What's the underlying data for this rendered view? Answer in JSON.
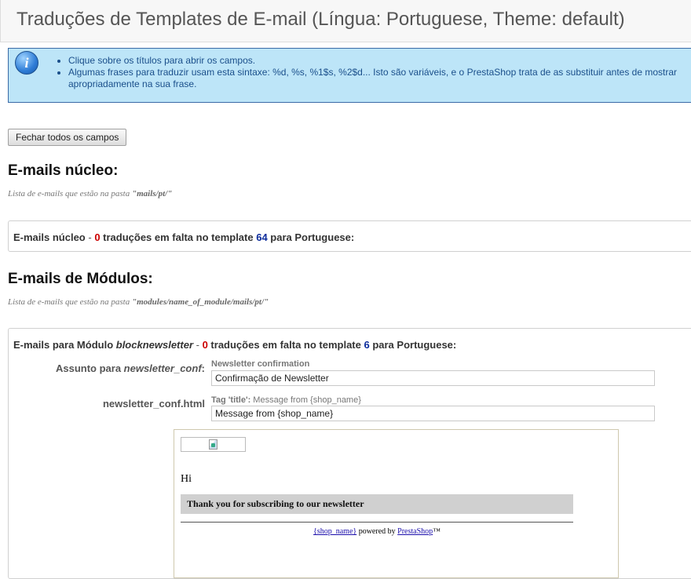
{
  "page_title": "Traduções de Templates de E-mail (Língua: Portuguese, Theme: default)",
  "info": {
    "items": [
      "Clique sobre os títulos para abrir os campos.",
      "Algumas frases para traduzir usam esta sintaxe: %d, %s, %1$s, %2$d... Isto são variáveis, e o PrestaShop trata de as substituir antes de mostrar apropriadamente na sua frase."
    ]
  },
  "close_all_button": "Fechar todos os campos",
  "core": {
    "heading": "E-mails núcleo:",
    "subtitle_prefix": "Lista de e-mails que estão na pasta ",
    "subtitle_path": "\"mails/pt/\"",
    "line_label": "E-mails núcleo",
    "dash": " - ",
    "missing_count": "0",
    "missing_text": " traduções em falta no template ",
    "template_count": "64",
    "lang_text": " para Portuguese:"
  },
  "modules": {
    "heading": "E-mails de Módulos:",
    "subtitle_prefix": "Lista de e-mails que estão na pasta ",
    "subtitle_path": "\"modules/name_of_module/mails/pt/\"",
    "line_label_prefix": "E-mails para Módulo ",
    "module_name": "blocknewsletter",
    "dash": " - ",
    "missing_count": "0",
    "missing_text": " traduções em falta no template ",
    "template_count": "6",
    "lang_text": " para Portuguese:",
    "subject_label_prefix": "Assunto para ",
    "subject_label_name": "newsletter_conf",
    "subject_label_suffix": ":",
    "subject_original": "Newsletter confirmation",
    "subject_value": "Confirmação de Newsletter",
    "html_label": "newsletter_conf.html",
    "title_tag_label": "Tag 'title':",
    "title_tag_original": " Message from {shop_name}",
    "title_value": "Message from {shop_name}"
  },
  "preview": {
    "greeting": "Hi",
    "banner": "Thank you for subscribing to our newsletter",
    "footer_link1": "{shop_name}",
    "footer_mid": " powered by ",
    "footer_link2": "PrestaShop",
    "footer_tm": "™"
  }
}
